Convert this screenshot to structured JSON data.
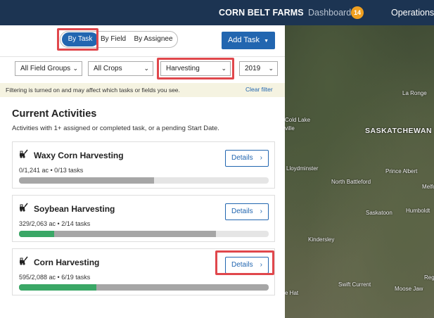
{
  "header": {
    "brand": "CORN BELT FARMS",
    "dashboard_label": "Dashboard",
    "dashboard_count": "14",
    "operations_label": "Operations"
  },
  "view_toggle": {
    "by_task": "By Task",
    "by_field": "By Field",
    "by_assignee": "By Assignee",
    "selected": "By Task"
  },
  "add_task_label": "Add Task",
  "filters": {
    "field_groups": "All Field Groups",
    "crops": "All Crops",
    "operation": "Harvesting",
    "year": "2019"
  },
  "filter_notice": {
    "text": "Filtering is turned on and may affect which tasks or fields you see.",
    "clear_label": "Clear filter"
  },
  "activities": {
    "title": "Current Activities",
    "subtitle": "Activities with 1+ assigned or completed task, or a pending Start Date.",
    "details_label": "Details",
    "items": [
      {
        "name": "Waxy Corn Harvesting",
        "stats": "0/1,241 ac • 0/13 tasks",
        "done_fraction": 0.0,
        "task_fraction": 0.54
      },
      {
        "name": "Soybean Harvesting",
        "stats": "329/2,063 ac • 2/14 tasks",
        "done_fraction": 0.14,
        "task_fraction": 0.79
      },
      {
        "name": "Corn Harvesting",
        "stats": "595/2,088 ac • 6/19 tasks",
        "done_fraction": 0.31,
        "task_fraction": 1.0
      }
    ]
  },
  "map": {
    "labels": [
      "La Ronge",
      "Cold Lake",
      "ville",
      "SASKATCHEWAN",
      "Lloydminster",
      "Prince Albert",
      "North Battleford",
      "Melfo",
      "Saskatoon",
      "Humboldt",
      "Kindersley",
      "Swift Current",
      "Moose Jaw",
      "Regi",
      "e Hat"
    ]
  },
  "colors": {
    "nav_bg": "#1c3452",
    "primary": "#2266b0",
    "highlight": "#e0474c",
    "progress_done": "#3aa766",
    "progress_tasks": "#a6a6a6",
    "badge": "#f0a020"
  }
}
